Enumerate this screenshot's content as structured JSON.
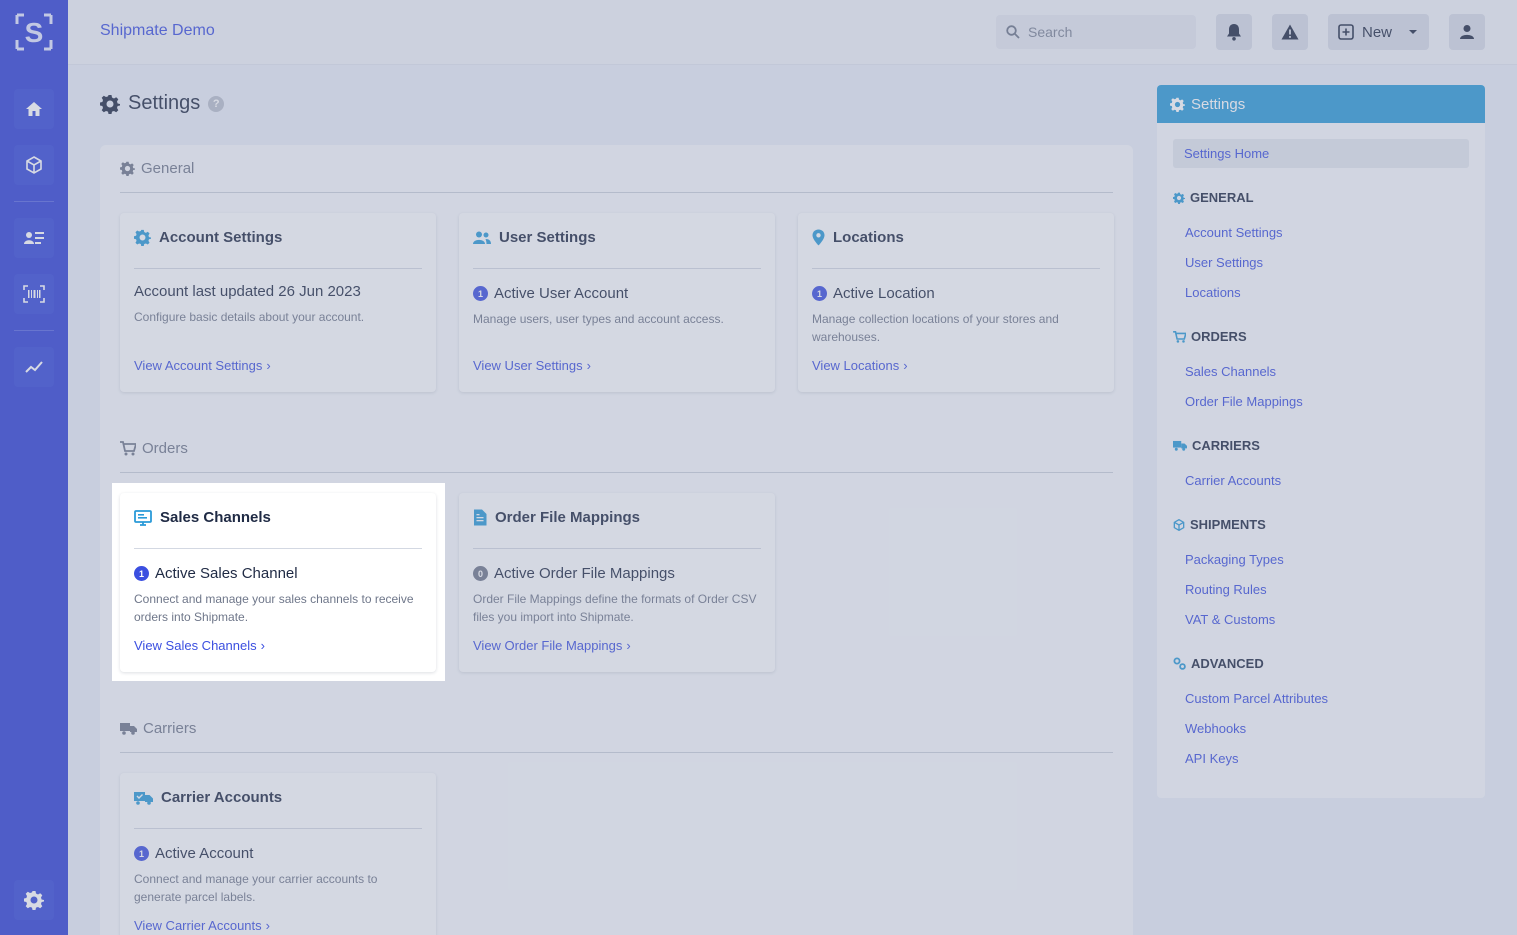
{
  "app": {
    "brand": "Shipmate Demo",
    "logo_letter": "S"
  },
  "topbar": {
    "search_placeholder": "Search",
    "new_label": "New"
  },
  "page": {
    "title": "Settings",
    "help": "?"
  },
  "sections": {
    "general": "General",
    "orders": "Orders",
    "carriers": "Carriers"
  },
  "cards": {
    "account": {
      "title": "Account Settings",
      "status": "Account last updated 26 Jun 2023",
      "desc": "Configure basic details about your account.",
      "link": "View Account Settings"
    },
    "users": {
      "title": "User Settings",
      "count": "1",
      "status": "Active User Account",
      "desc": "Manage users, user types and account access.",
      "link": "View User Settings"
    },
    "locations": {
      "title": "Locations",
      "count": "1",
      "status": "Active Location",
      "desc": "Manage collection locations of your stores and warehouses.",
      "link": "View Locations"
    },
    "sales_channels": {
      "title": "Sales Channels",
      "count": "1",
      "status": "Active Sales Channel",
      "desc": "Connect and manage your sales channels to receive orders into Shipmate.",
      "link": "View Sales Channels"
    },
    "order_file_mappings": {
      "title": "Order File Mappings",
      "count": "0",
      "status": "Active Order File Mappings",
      "desc": "Order File Mappings define the formats of Order CSV files you import into Shipmate.",
      "link": "View Order File Mappings"
    },
    "carrier_accounts": {
      "title": "Carrier Accounts",
      "count": "1",
      "status": "Active Account",
      "desc": "Connect and manage your carrier accounts to generate parcel labels.",
      "link": "View Carrier Accounts"
    }
  },
  "sidebar": {
    "title": "Settings",
    "home": "Settings Home",
    "groups": {
      "general": {
        "label": "GENERAL",
        "items": [
          "Account Settings",
          "User Settings",
          "Locations"
        ]
      },
      "orders": {
        "label": "ORDERS",
        "items": [
          "Sales Channels",
          "Order File Mappings"
        ]
      },
      "carriers": {
        "label": "CARRIERS",
        "items": [
          "Carrier Accounts"
        ]
      },
      "shipments": {
        "label": "SHIPMENTS",
        "items": [
          "Packaging Types",
          "Routing Rules",
          "VAT & Customs"
        ]
      },
      "advanced": {
        "label": "ADVANCED",
        "items": [
          "Custom Parcel Attributes",
          "Webhooks",
          "API Keys"
        ]
      }
    }
  },
  "colors": {
    "rail": "#2f3fd6",
    "accent": "#3b4fe0",
    "sidebar_header": "#2a9ad8"
  }
}
